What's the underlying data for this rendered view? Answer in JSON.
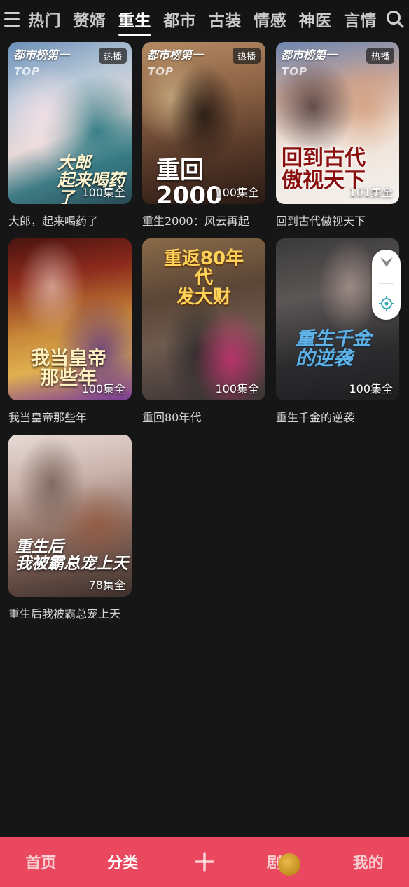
{
  "categories": [
    "热门",
    "赘婿",
    "重生",
    "都市",
    "古装",
    "情感",
    "神医",
    "言情"
  ],
  "active_category_index": 2,
  "dramas": [
    {
      "title": "大郎，起来喝药了",
      "episodes": "100集全",
      "rank_badge": "都市榜第一",
      "rank_sub": "TOP",
      "hot": "热播",
      "poster_text": "大郎\n起来喝药了"
    },
    {
      "title": "重生2000：风云再起",
      "episodes": "100集全",
      "rank_badge": "都市榜第一",
      "rank_sub": "TOP",
      "hot": "热播",
      "poster_text": "重回2000"
    },
    {
      "title": "回到古代傲视天下",
      "episodes": "101集全",
      "rank_badge": "都市榜第一",
      "rank_sub": "TOP",
      "hot": "热播",
      "poster_text": "回到古代\n傲视天下"
    },
    {
      "title": "我当皇帝那些年",
      "episodes": "100集全",
      "poster_text": "我当皇帝\n那些年"
    },
    {
      "title": "重回80年代",
      "episodes": "100集全",
      "poster_text": "重返80年代\n发大财"
    },
    {
      "title": "重生千金的逆袭",
      "episodes": "100集全",
      "poster_text": "重生千金\n的逆袭"
    },
    {
      "title": "重生后我被霸总宠上天",
      "episodes": "78集全",
      "poster_text": "重生后\n我被霸总宠上天"
    }
  ],
  "bottom_nav": {
    "home": "首页",
    "category": "分类",
    "drama": "剧",
    "mine": "我的",
    "active": "category"
  },
  "colors": {
    "background": "#161616",
    "nav_bar": "#e9485f",
    "active_tab": "#ffffff"
  },
  "icons": {
    "menu": "menu-icon",
    "search": "search-icon",
    "plus": "plus-icon",
    "collapse": "chevron-down-icon",
    "locate": "locate-icon"
  }
}
